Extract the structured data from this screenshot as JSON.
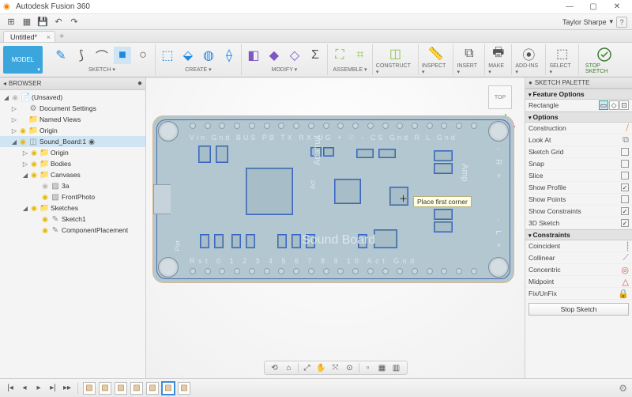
{
  "window": {
    "title": "Autodesk Fusion 360",
    "user": "Taylor Sharpe"
  },
  "win_controls": {
    "min": "—",
    "max": "▢",
    "close": "✕"
  },
  "qat": {
    "home": "⊞",
    "file": "▦",
    "save": "💾",
    "undo": "↶",
    "redo": "↷",
    "help": "?",
    "user_caret": "▾"
  },
  "tab": {
    "label": "Untitled*",
    "close": "×",
    "add": "+"
  },
  "mode": {
    "label": "MODEL",
    "caret": "▾"
  },
  "ribbon_groups": [
    {
      "key": "sketch",
      "label": "SKETCH ▾",
      "icons": [
        {
          "g": "✎",
          "c": "c-blue"
        },
        {
          "g": "⟆",
          "c": "c-dark"
        },
        {
          "g": "⌒",
          "c": "c-dark"
        },
        {
          "g": "■",
          "c": "c-blue",
          "active": true
        },
        {
          "g": "○",
          "c": "c-dark"
        }
      ]
    },
    {
      "key": "create",
      "label": "CREATE ▾",
      "icons": [
        {
          "g": "⬚",
          "c": "c-blue"
        },
        {
          "g": "⬙",
          "c": "c-blue"
        },
        {
          "g": "◍",
          "c": "c-blue"
        },
        {
          "g": "⟠",
          "c": "c-blue"
        }
      ]
    },
    {
      "key": "modify",
      "label": "MODIFY ▾",
      "icons": [
        {
          "g": "◧",
          "c": "c-purple"
        },
        {
          "g": "◆",
          "c": "c-purple"
        },
        {
          "g": "◇",
          "c": "c-purple"
        },
        {
          "g": "Σ",
          "c": "c-dark"
        }
      ]
    },
    {
      "key": "assemble",
      "label": "ASSEMBLE ▾",
      "icons": [
        {
          "g": "⛶",
          "c": "c-lime"
        },
        {
          "g": "⌗",
          "c": "c-lime"
        }
      ]
    },
    {
      "key": "construct",
      "label": "CONSTRUCT ▾",
      "icons": [
        {
          "g": "◫",
          "c": "c-lime"
        }
      ]
    },
    {
      "key": "inspect",
      "label": "INSPECT ▾",
      "icons": [
        {
          "g": "📏",
          "c": "c-dark"
        }
      ]
    },
    {
      "key": "insert",
      "label": "INSERT ▾",
      "icons": [
        {
          "g": "⧉",
          "c": "c-dark"
        }
      ]
    },
    {
      "key": "make",
      "label": "MAKE ▾",
      "icons": [
        {
          "g": "🖶",
          "c": "c-dark"
        }
      ]
    },
    {
      "key": "addins",
      "label": "ADD-INS ▾",
      "icons": [
        {
          "g": "⦿",
          "c": "c-dark"
        }
      ]
    },
    {
      "key": "select",
      "label": "SELECT ▾",
      "icons": [
        {
          "g": "⬚",
          "c": "c-dark"
        }
      ]
    }
  ],
  "ribbon_stop": {
    "label": "STOP SKETCH",
    "glyph": "◯✓"
  },
  "browser": {
    "title": "BROWSER",
    "bullet": "●",
    "collapse": "◂",
    "nodes": [
      {
        "lvl": 0,
        "exp": "◢",
        "bulb": "off",
        "ico": "doc",
        "label": "(Unsaved)",
        "sel": false
      },
      {
        "lvl": 1,
        "exp": "▷",
        "bulb": "",
        "ico": "gear",
        "label": "Document Settings"
      },
      {
        "lvl": 1,
        "exp": "▷",
        "bulb": "",
        "ico": "folder",
        "label": "Named Views"
      },
      {
        "lvl": 1,
        "exp": "▷",
        "bulb": "on",
        "ico": "folder",
        "label": "Origin"
      },
      {
        "lvl": 1,
        "exp": "◢",
        "bulb": "on",
        "ico": "comp",
        "label": "Sound_Board:1",
        "sel": true,
        "radio": true
      },
      {
        "lvl": 2,
        "exp": "▷",
        "bulb": "on",
        "ico": "folder",
        "label": "Origin"
      },
      {
        "lvl": 2,
        "exp": "▷",
        "bulb": "on",
        "ico": "folder",
        "label": "Bodies"
      },
      {
        "lvl": 2,
        "exp": "◢",
        "bulb": "on",
        "ico": "folder",
        "label": "Canvases"
      },
      {
        "lvl": 3,
        "exp": "",
        "bulb": "off",
        "ico": "canvas",
        "label": "3a"
      },
      {
        "lvl": 3,
        "exp": "",
        "bulb": "on",
        "ico": "canvas",
        "label": "FrontPhoto"
      },
      {
        "lvl": 2,
        "exp": "◢",
        "bulb": "on",
        "ico": "folder",
        "label": "Sketches"
      },
      {
        "lvl": 3,
        "exp": "",
        "bulb": "on",
        "ico": "sketch",
        "label": "Sketch1"
      },
      {
        "lvl": 3,
        "exp": "",
        "bulb": "on",
        "ico": "sketch",
        "label": "ComponentPlacement"
      }
    ]
  },
  "canvas": {
    "tooltip": "Place first corner",
    "viewcube": "TOP",
    "silk": {
      "title": "Sound Board",
      "brand": "Adafruit",
      "top_labels": "Vin Gnd BUS PB  TX RX UG   + ☉ - CS Gnd  R    L  Gnd",
      "bot_labels": "Rst 0   1   2   3   4   5   6   7   8   9  10 Act Gnd",
      "right_top": "- R +",
      "right_bot": "- L +",
      "right_amp": "Amp",
      "pwr": "Pwr",
      "act": "Act"
    }
  },
  "navbar": {
    "items": [
      "⟲",
      "⌂",
      "⤢",
      "✋",
      "⤧",
      "⊙",
      "▫",
      "▦",
      "▥"
    ]
  },
  "palette": {
    "title": "SKETCH PALETTE",
    "bullet": "●",
    "feature": {
      "hdr": "Feature Options",
      "rect": "Rectangle"
    },
    "options": {
      "hdr": "Options",
      "rows": [
        {
          "l": "Construction",
          "t": "glyph",
          "g": "⧸",
          "cls": "orange"
        },
        {
          "l": "Look At",
          "t": "glyph",
          "g": "⧉",
          "cls": "gray"
        },
        {
          "l": "Sketch Grid",
          "t": "chk",
          "on": false
        },
        {
          "l": "Snap",
          "t": "chk",
          "on": false
        },
        {
          "l": "Slice",
          "t": "chk",
          "on": false
        },
        {
          "l": "Show Profile",
          "t": "chk",
          "on": true
        },
        {
          "l": "Show Points",
          "t": "chk",
          "on": false
        },
        {
          "l": "Show Constraints",
          "t": "chk",
          "on": true
        },
        {
          "l": "3D Sketch",
          "t": "chk",
          "on": true
        }
      ]
    },
    "constraints": {
      "hdr": "Constraints",
      "rows": [
        {
          "l": "Coincident",
          "g": "⸽",
          "cls": "gray"
        },
        {
          "l": "Collinear",
          "g": "⟋",
          "cls": "gray"
        },
        {
          "l": "Concentric",
          "g": "◎",
          "cls": "red"
        },
        {
          "l": "Midpoint",
          "g": "△",
          "cls": "red"
        },
        {
          "l": "Fix/UnFix",
          "g": "🔒",
          "cls": "gray"
        }
      ]
    },
    "stop": "Stop Sketch"
  },
  "timeline": {
    "play": [
      "|◂",
      "◂",
      "▸",
      "▸|",
      "▸▸"
    ],
    "features": 7,
    "selected": 5
  }
}
